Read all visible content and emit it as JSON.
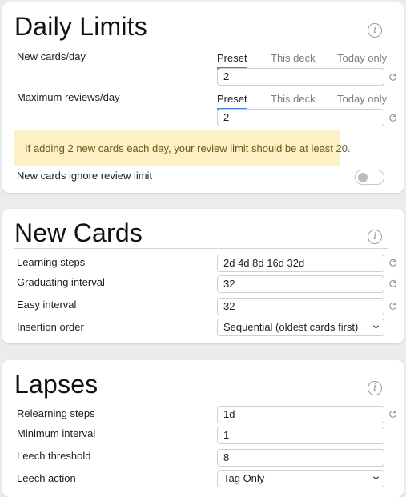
{
  "daily_limits": {
    "title": "Daily Limits",
    "new_cards": {
      "label": "New cards/day",
      "tabs": [
        "Preset",
        "This deck",
        "Today only"
      ],
      "value": "2"
    },
    "max_reviews": {
      "label": "Maximum reviews/day",
      "tabs": [
        "Preset",
        "This deck",
        "Today only"
      ],
      "value": "2"
    },
    "warning": "If adding 2 new cards each day, your review limit should be at least 20.",
    "ignore_review_limit": {
      "label": "New cards ignore review limit",
      "enabled": false
    }
  },
  "new_cards": {
    "title": "New Cards",
    "learning_steps": {
      "label": "Learning steps",
      "value": "2d 4d 8d 16d 32d"
    },
    "graduating_interval": {
      "label": "Graduating interval",
      "value": "32"
    },
    "easy_interval": {
      "label": "Easy interval",
      "value": "32"
    },
    "insertion_order": {
      "label": "Insertion order",
      "value": "Sequential (oldest cards first)"
    }
  },
  "lapses": {
    "title": "Lapses",
    "relearning_steps": {
      "label": "Relearning steps",
      "value": "1d"
    },
    "minimum_interval": {
      "label": "Minimum interval",
      "value": "1"
    },
    "leech_threshold": {
      "label": "Leech threshold",
      "value": "8"
    },
    "leech_action": {
      "label": "Leech action",
      "value": "Tag Only"
    }
  },
  "icons": {
    "info": "info-circle-icon",
    "reset": "reset-arrow-icon",
    "dropdown": "chevron-down-icon"
  },
  "colors": {
    "accent": "#3a7ee6",
    "warning_bg": "#fcf0c4",
    "warning_text": "#6c5a1a"
  }
}
